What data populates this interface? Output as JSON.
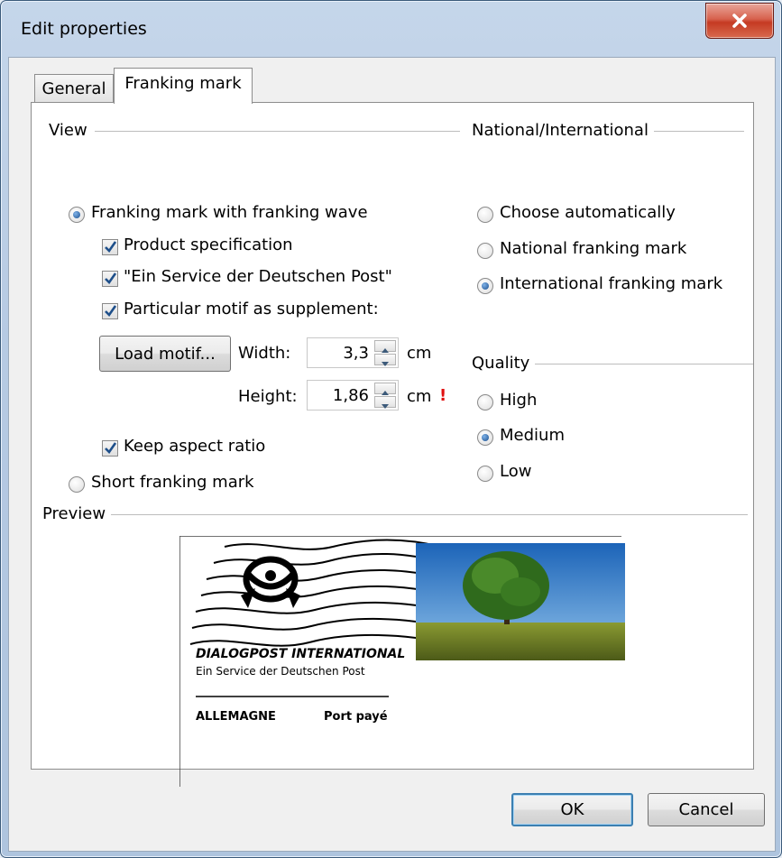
{
  "window": {
    "title": "Edit properties"
  },
  "tabs": [
    {
      "label": "General",
      "active": false
    },
    {
      "label": "Franking mark",
      "active": true
    }
  ],
  "view": {
    "label": "View",
    "options": {
      "wave": {
        "label": "Franking mark with franking wave",
        "selected": true
      },
      "short": {
        "label": "Short franking mark",
        "selected": false
      }
    },
    "checks": {
      "product": {
        "label": "Product specification",
        "checked": true
      },
      "service": {
        "label": "\"Ein Service der Deutschen Post\"",
        "checked": true
      },
      "motif": {
        "label": "Particular motif as supplement:",
        "checked": true
      },
      "aspect": {
        "label": "Keep aspect ratio",
        "checked": true
      }
    },
    "load_motif_label": "Load motif...",
    "width": {
      "label": "Width:",
      "value": "3,3",
      "unit": "cm"
    },
    "height": {
      "label": "Height:",
      "value": "1,86",
      "unit": "cm",
      "warning": "!"
    }
  },
  "national": {
    "label": "National/International",
    "options": [
      {
        "label": "Choose automatically",
        "selected": false
      },
      {
        "label": "National franking mark",
        "selected": false
      },
      {
        "label": "International franking mark",
        "selected": true
      }
    ]
  },
  "quality": {
    "label": "Quality",
    "options": [
      {
        "label": "High",
        "selected": false
      },
      {
        "label": "Medium",
        "selected": true
      },
      {
        "label": "Low",
        "selected": false
      }
    ]
  },
  "preview": {
    "label": "Preview",
    "line1": "DIALOGPOST  INTERNATIONAL",
    "line2": "Ein Service der Deutschen Post",
    "country": "ALLEMAGNE",
    "postage": "Port payé"
  },
  "buttons": {
    "ok": "OK",
    "cancel": "Cancel"
  },
  "colors": {
    "warning": "#e01010",
    "sky": "#2a78c8",
    "field": "#a8a830"
  }
}
